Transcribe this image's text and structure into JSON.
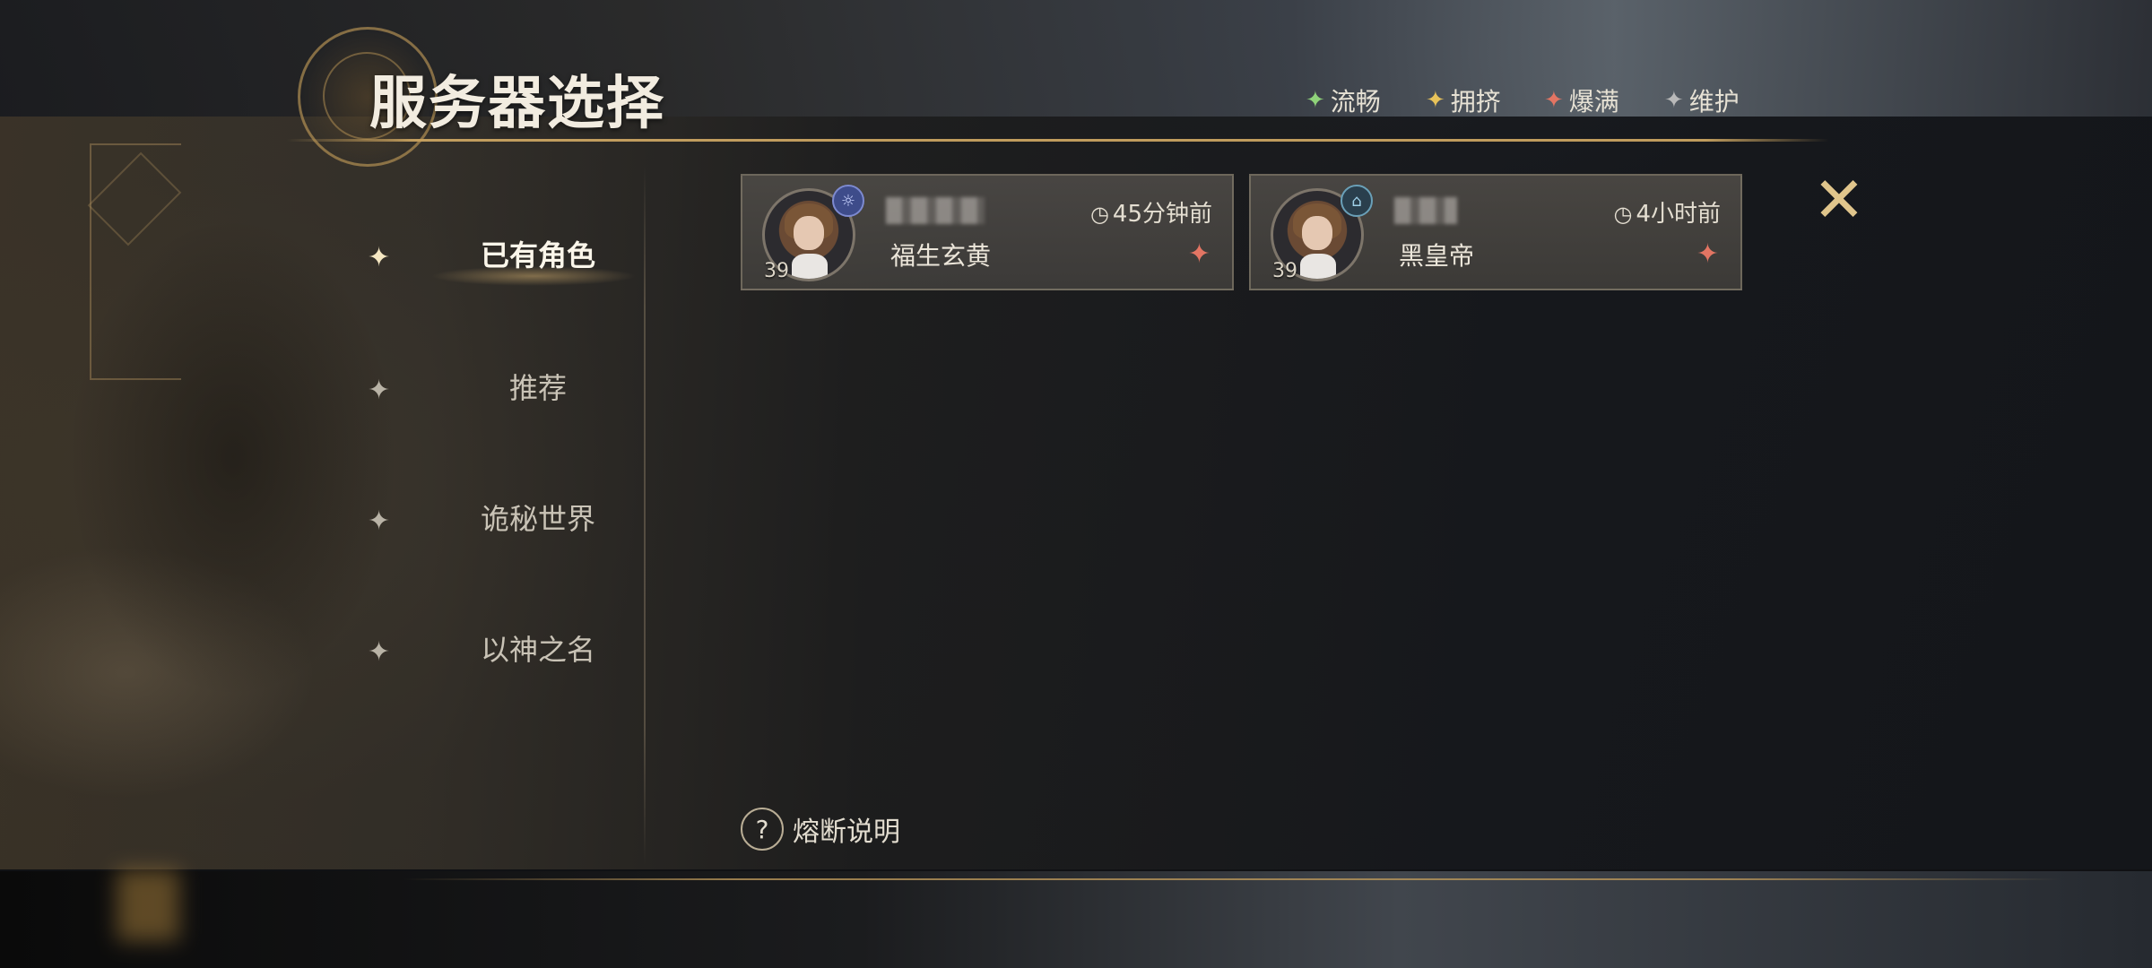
{
  "header": {
    "title": "服务器选择"
  },
  "legend": [
    {
      "label": "流畅",
      "color": "#8fd37a"
    },
    {
      "label": "拥挤",
      "color": "#e8c35a"
    },
    {
      "label": "爆满",
      "color": "#e37563"
    },
    {
      "label": "维护",
      "color": "#b9b9b9"
    }
  ],
  "sidebar": {
    "items": [
      {
        "label": "已有角色",
        "active": true
      },
      {
        "label": "推荐",
        "active": false
      },
      {
        "label": "诡秘世界",
        "active": false
      },
      {
        "label": "以神之名",
        "active": false
      }
    ]
  },
  "servers": [
    {
      "level": "39",
      "name": "福生玄黄",
      "last_login": "45分钟前",
      "status_color": "#e37563"
    },
    {
      "level": "39",
      "name": "黑皇帝",
      "last_login": "4小时前",
      "status_color": "#e37563"
    }
  ],
  "help": {
    "label": "熔断说明"
  },
  "icons": {
    "close": "close-icon",
    "clock": "clock-icon",
    "help": "question-icon",
    "status": "status-star-icon"
  }
}
